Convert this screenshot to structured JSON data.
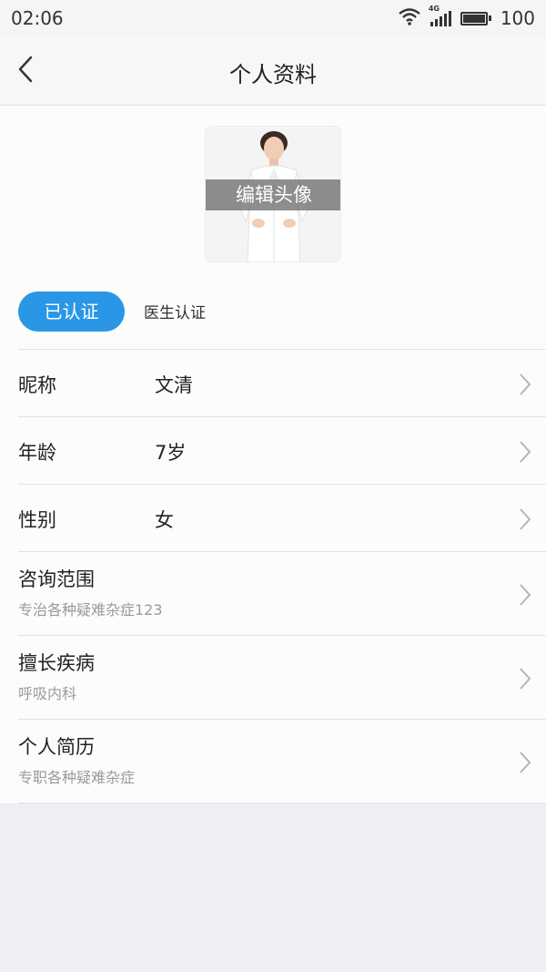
{
  "status_bar": {
    "time": "02:06",
    "network": "4G",
    "battery": "100",
    "icons": [
      "wifi-icon",
      "signal-icon",
      "battery-icon"
    ]
  },
  "header": {
    "title": "个人资料",
    "back_icon": "chevron-left-icon"
  },
  "avatar": {
    "overlay_label": "编辑头像"
  },
  "certification": {
    "status_label": "已认证",
    "link_label": "医生认证",
    "accent_color": "#2a97e6"
  },
  "profile_rows": [
    {
      "label": "昵称",
      "value": "文清"
    },
    {
      "label": "年龄",
      "value": "7岁"
    },
    {
      "label": "性别",
      "value": "女"
    },
    {
      "label": "咨询范围",
      "sub": "专治各种疑难杂症123"
    },
    {
      "label": "擅长疾病",
      "sub": "呼吸内科"
    },
    {
      "label": "个人简历",
      "sub": "专职各种疑难杂症"
    }
  ]
}
